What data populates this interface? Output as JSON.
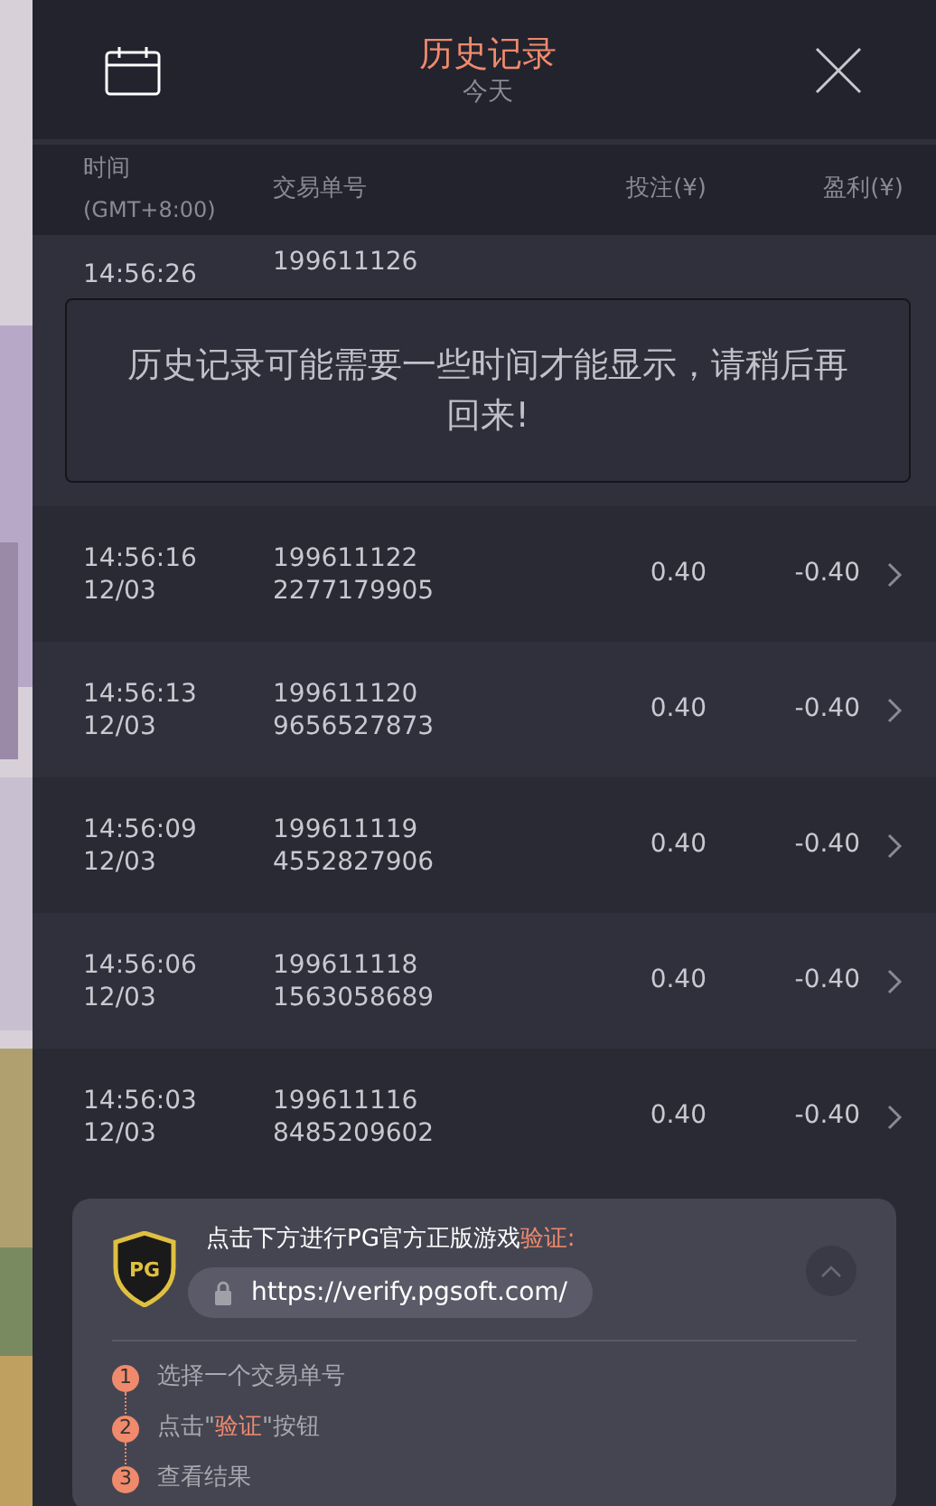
{
  "header": {
    "title": "历史记录",
    "subtitle": "今天"
  },
  "columns": [
    {
      "label": "时间",
      "sublabel": "(GMT+8:00)"
    },
    {
      "label": "交易单号"
    },
    {
      "label": "投注(¥)"
    },
    {
      "label": "盈利(¥)"
    }
  ],
  "rows": [
    {
      "time": "14:56:26",
      "id": "199611126"
    },
    {
      "time": "14:56:16",
      "date": "12/03",
      "id": "199611122",
      "id2": "2277179905",
      "bet": "0.40",
      "profit": "-0.40"
    },
    {
      "time": "14:56:13",
      "date": "12/03",
      "id": "199611120",
      "id2": "9656527873",
      "bet": "0.40",
      "profit": "-0.40"
    },
    {
      "time": "14:56:09",
      "date": "12/03",
      "id": "199611119",
      "id2": "4552827906",
      "bet": "0.40",
      "profit": "-0.40"
    },
    {
      "time": "14:56:06",
      "date": "12/03",
      "id": "199611118",
      "id2": "1563058689",
      "bet": "0.40",
      "profit": "-0.40"
    },
    {
      "time": "14:56:03",
      "date": "12/03",
      "id": "199611116",
      "id2": "8485209602",
      "bet": "0.40",
      "profit": "-0.40"
    }
  ],
  "toast": "历史记录可能需要一些时间才能显示，请稍后再回来!",
  "verify": {
    "logo": "PG",
    "title": [
      {
        "text": "点击下方进行PG官方正版游戏",
        "highlight": false
      },
      {
        "text": "验证:",
        "highlight": true
      }
    ],
    "url": "https://verify.pgsoft.com/",
    "expanded": true,
    "steps": [
      {
        "number": "1",
        "parts": [
          {
            "text": "选择一个交易单号",
            "highlight": false
          }
        ]
      },
      {
        "number": "2",
        "parts": [
          {
            "text": "点击\"",
            "highlight": false
          },
          {
            "text": "验证",
            "highlight": true
          },
          {
            "text": "\"按钮",
            "highlight": false
          }
        ]
      },
      {
        "number": "3",
        "parts": [
          {
            "text": "查看结果",
            "highlight": false
          }
        ]
      }
    ]
  }
}
